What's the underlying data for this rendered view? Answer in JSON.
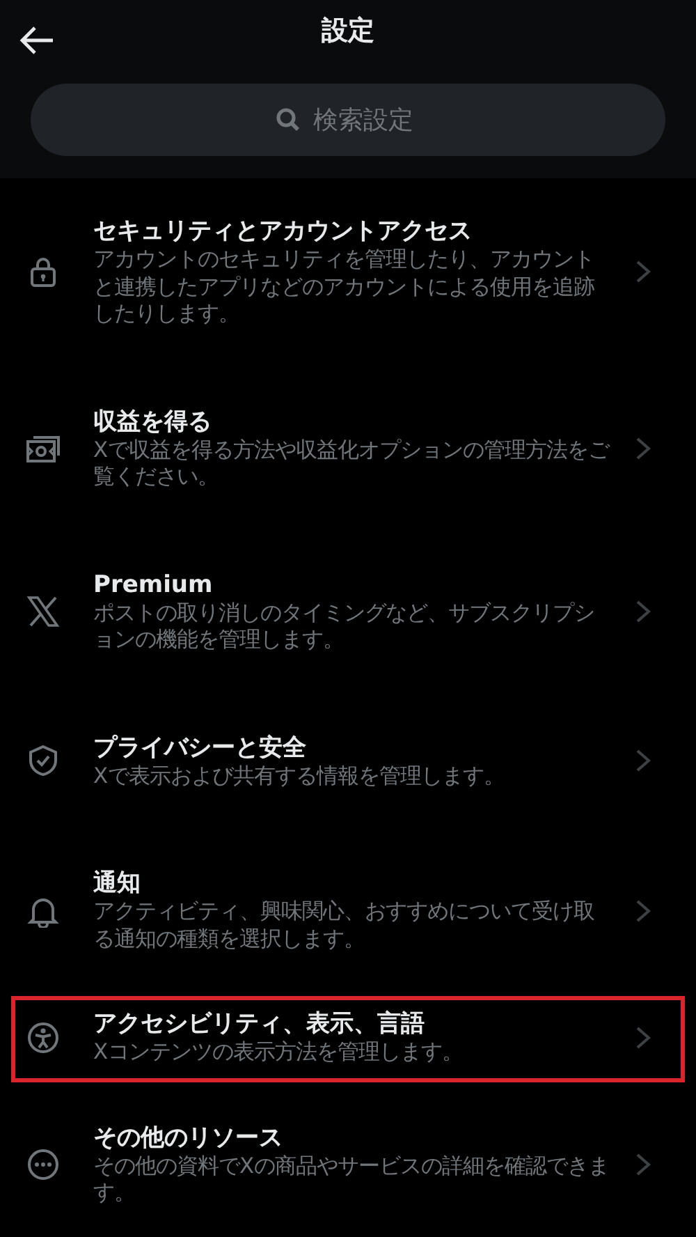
{
  "header": {
    "title": "設定"
  },
  "search": {
    "placeholder": "検索設定"
  },
  "items": [
    {
      "title": "セキュリティとアカウントアクセス",
      "description": "アカウントのセキュリティを管理したり、アカウントと連携したアプリなどのアカウントによる使用を追跡したりします。",
      "highlighted": false
    },
    {
      "title": "収益を得る",
      "description": "Xで収益を得る方法や収益化オプションの管理方法をご覧ください。",
      "highlighted": false
    },
    {
      "title": "Premium",
      "description": "ポストの取り消しのタイミングなど、サブスクリプションの機能を管理します。",
      "highlighted": false
    },
    {
      "title": "プライバシーと安全",
      "description": "Xで表示および共有する情報を管理します。",
      "highlighted": false
    },
    {
      "title": "通知",
      "description": "アクティビティ、興味関心、おすすめについて受け取る通知の種類を選択します。",
      "highlighted": false
    },
    {
      "title": "アクセシビリティ、表示、言語",
      "description": "Xコンテンツの表示方法を管理します。",
      "highlighted": true
    },
    {
      "title": "その他のリソース",
      "description": "その他の資料でXの商品やサービスの詳細を確認できます。",
      "highlighted": false
    }
  ]
}
